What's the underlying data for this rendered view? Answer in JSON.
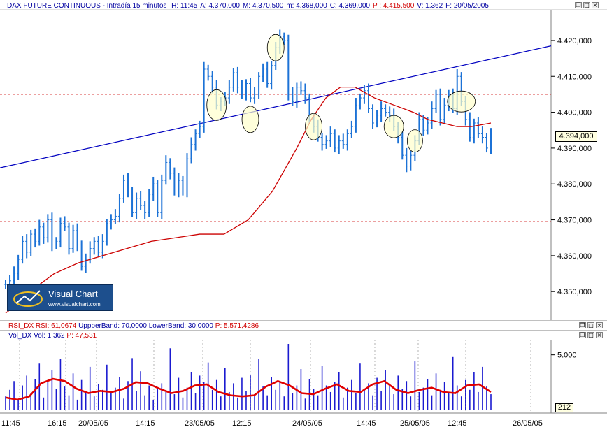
{
  "header": {
    "symbol": "DAX FUTURE CONTINUOUS - Intradía 15 minutos",
    "fields": [
      {
        "label": "H:",
        "value": "11:45",
        "color": "#0000a0"
      },
      {
        "label": "A:",
        "value": "4.370,000",
        "color": "#0000a0"
      },
      {
        "label": "M:",
        "value": "4.370,500",
        "color": "#0000a0"
      },
      {
        "label": "m:",
        "value": "4.368,000",
        "color": "#0000a0"
      },
      {
        "label": "C:",
        "value": "4.369,000",
        "color": "#0000a0"
      },
      {
        "label": "P :",
        "value": "4.415,500",
        "color": "#d00000"
      },
      {
        "label": "V:",
        "value": "1.362",
        "color": "#0000a0"
      },
      {
        "label": "F:",
        "value": "20/05/2005",
        "color": "#0000a0"
      }
    ]
  },
  "rsi_header": {
    "name": "RSI_DX",
    "rsi": "RSI: 61,0674",
    "upper": "UppperBand: 70,0000",
    "lower": "LowerBand: 30,0000",
    "p": "P: 5.571,4286"
  },
  "vol_header": {
    "name": "Vol_DX",
    "vol": "Vol: 1.362",
    "p": "P: 47,531"
  },
  "logo": {
    "title": "Visual Chart",
    "url": "www.visualchart.com"
  },
  "window_buttons": {
    "restore": "❐",
    "maximize": "□",
    "close": "×"
  },
  "colors": {
    "price": "#1c72d6",
    "sma": "#cc0000",
    "trendline": "#0000c0",
    "hline": "#cc0000",
    "volume": "#1a1ad0",
    "volume_avg": "#e00000",
    "ellipse_fill": "#ffffcc",
    "header_text": "#0000a0"
  },
  "chart_data": [
    {
      "type": "line",
      "title": "DAX FUTURE CONTINUOUS - Intradía 15 minutos",
      "y_ticks": [
        "4.420,000",
        "4.410,000",
        "4.400,000",
        "4.390,000",
        "4.380,000",
        "4.370,000",
        "4.360,000",
        "4.350,000"
      ],
      "y_tick_values": [
        4420,
        4410,
        4400,
        4390,
        4380,
        4370,
        4360,
        4350
      ],
      "ylim": [
        4344,
        4427
      ],
      "last_price_label": "4.394,000",
      "x_labels": [
        "11:45",
        "16:15",
        "20/05/05",
        "14:15",
        "23/05/05",
        "12:15",
        "24/05/05",
        "14:45",
        "25/05/05",
        "12:45",
        "26/05/05"
      ],
      "grid": false,
      "series": [
        {
          "name": "price",
          "style": "bars",
          "values": [
            4352,
            4353,
            4355,
            4359,
            4364,
            4361,
            4366,
            4364,
            4368,
            4365,
            4370,
            4363,
            4364,
            4369,
            4368,
            4362,
            4367,
            4363,
            4357,
            4359,
            4362,
            4364,
            4361,
            4364,
            4369,
            4370,
            4371,
            4376,
            4381,
            4378,
            4372,
            4376,
            4374,
            4372,
            4377,
            4380,
            4372,
            4381,
            4386,
            4383,
            4378,
            4381,
            4378,
            4387,
            4391,
            4394,
            4396,
            4412,
            4410,
            4407,
            4402,
            4403,
            4404,
            4407,
            4411,
            4407,
            4405,
            4408,
            4404,
            4405,
            4410,
            4412,
            4408,
            4413,
            4418,
            4421,
            4420,
            4405,
            4403,
            4407,
            4406,
            4404,
            4398,
            4396,
            4393,
            4391,
            4392,
            4394,
            4390,
            4392,
            4391,
            4394,
            4396,
            4402,
            4404,
            4406,
            4401,
            4397,
            4399,
            4401,
            4400,
            4399,
            4396,
            4393,
            4388,
            4385,
            4388,
            4392,
            4398,
            4395,
            4397,
            4401,
            4405,
            4398,
            4402,
            4405,
            4401,
            4410,
            4403,
            4398,
            4393,
            4397,
            4394,
            4393,
            4390,
            4394
          ],
          "last": 4394
        },
        {
          "name": "moving average",
          "style": "line",
          "values": [
            4344,
            4346,
            4350,
            4355,
            4358,
            4360,
            4362,
            4364,
            4365,
            4366,
            4366,
            4370,
            4378,
            4390,
            4398,
            4404,
            4407,
            4407,
            4404,
            4402,
            4400,
            4398,
            4397,
            4396,
            4396,
            4397
          ],
          "x_fraction": [
            0,
            0.02,
            0.05,
            0.1,
            0.15,
            0.2,
            0.25,
            0.3,
            0.35,
            0.4,
            0.45,
            0.5,
            0.55,
            0.6,
            0.63,
            0.66,
            0.69,
            0.72,
            0.76,
            0.8,
            0.84,
            0.87,
            0.9,
            0.93,
            0.96,
            1.0
          ]
        }
      ],
      "annotations": {
        "trendline": {
          "from": 4384.5,
          "to": 4418.5
        },
        "horizontal_lines": [
          4405,
          4369.5
        ],
        "circled_points": 8
      }
    },
    {
      "type": "bar",
      "title": "Vol_DX",
      "y_ticks": [
        "5.000"
      ],
      "last_value_label": "212",
      "x_labels": [
        "11:45",
        "16:15",
        "20/05/05",
        "14:15",
        "23/05/05",
        "12:15",
        "24/05/05",
        "14:45",
        "25/05/05",
        "12:45",
        "26/05/05"
      ],
      "series": [
        {
          "name": "volume",
          "values": [
            1200,
            1800,
            2600,
            900,
            2200,
            3100,
            1500,
            2800,
            4200,
            1100,
            2500,
            3600,
            1900,
            4600,
            2100,
            1300,
            3300,
            900,
            2700,
            1600,
            3900,
            1200,
            2300,
            1800,
            4100,
            1500,
            2000,
            3000,
            1000,
            2600,
            4700,
            1700,
            3500,
            1300,
            2200,
            900,
            1900,
            2400,
            1600,
            5600,
            1400,
            2900,
            1100,
            2000,
            3400,
            1500,
            3100,
            2500,
            4300,
            1800,
            2700,
            1200,
            3800,
            1600,
            2400,
            1100,
            2900,
            1700,
            3200,
            1400,
            4600,
            2100,
            1300,
            3000,
            1800,
            2500,
            1200,
            6000,
            1500,
            2200,
            3700,
            1000,
            2800,
            1900,
            1300,
            4000,
            2200,
            1600,
            2500,
            3400,
            1100,
            2000,
            2700,
            1500,
            4200,
            1800,
            2400,
            1300,
            2900,
            1700,
            3600,
            2200,
            1400,
            3100,
            1900,
            2600,
            1200,
            4400,
            1600,
            2000,
            2800,
            1300,
            3300,
            1800,
            2500,
            1500,
            4800,
            2200,
            1200,
            2700,
            1800,
            3400,
            1600,
            3900,
            2100,
            1400
          ]
        },
        {
          "name": "volume average",
          "style": "line",
          "values": [
            1100,
            900,
            1200,
            2400,
            2800,
            2600,
            1900,
            1500,
            1700,
            1600,
            1900,
            2500,
            2400,
            1900,
            1500,
            1700,
            2200,
            2300,
            1600,
            1300,
            1200,
            1300,
            2100,
            2600,
            2200,
            1500,
            1400,
            1900,
            2300,
            1700,
            1600,
            2300,
            2600,
            1800,
            1500,
            1800,
            2000,
            1600,
            1500,
            2200,
            2300,
            1600
          ]
        }
      ]
    }
  ]
}
